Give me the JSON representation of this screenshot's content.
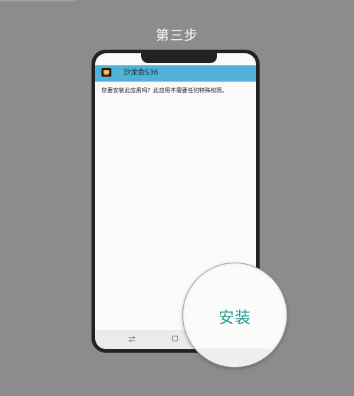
{
  "step_title": "第三步",
  "dialog": {
    "app_name": "沙龙会S36",
    "prompt": "您要安装此应用吗？此应用不需要任何特殊权限。"
  },
  "install_button": "安装",
  "colors": {
    "background": "#8c8c8c",
    "app_bar": "#4fb2d6",
    "install_accent": "#1e9a8e"
  },
  "icons": {
    "app": "app-icon",
    "nav_back": "back-icon",
    "nav_home": "home-square-icon"
  }
}
